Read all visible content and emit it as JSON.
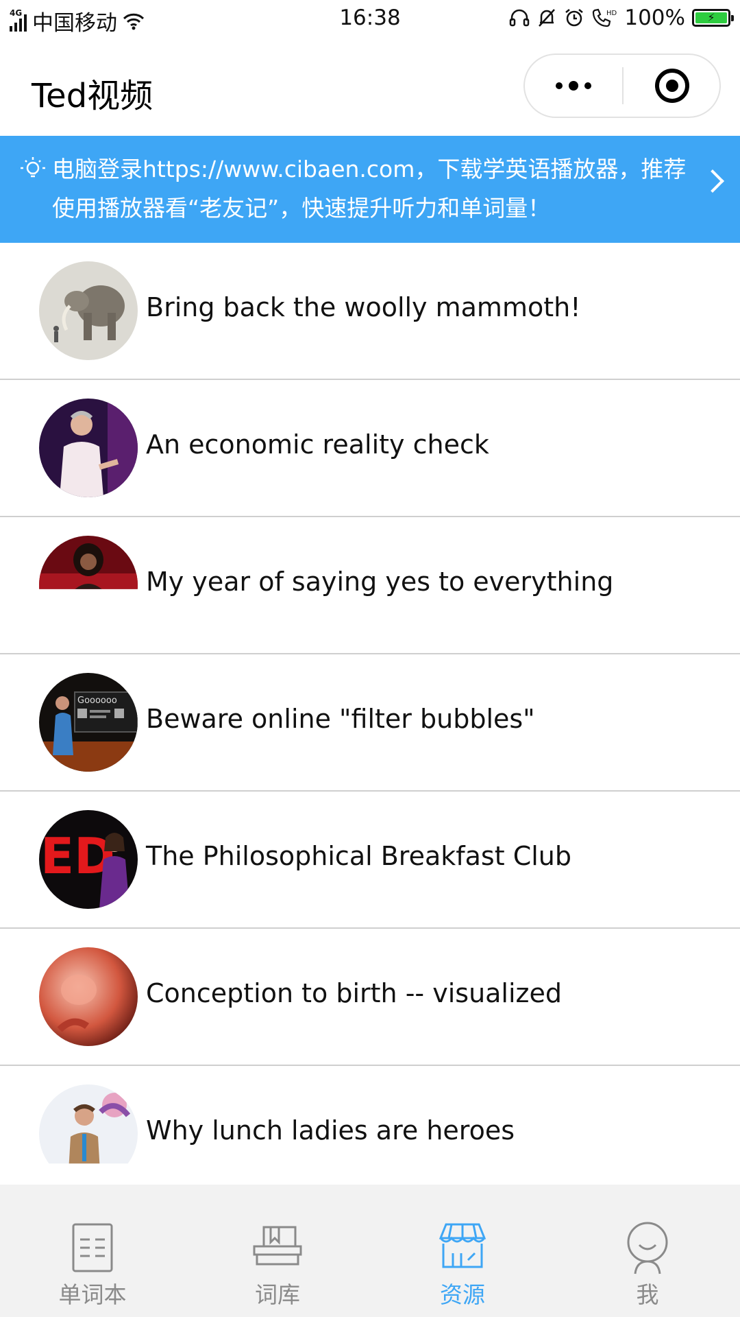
{
  "status_bar": {
    "network": "4G",
    "carrier": "中国移动",
    "time": "16:38",
    "battery": "100%",
    "icons": [
      "signal-icon",
      "wifi-icon",
      "headset-icon",
      "silent-bell-icon",
      "alarm-icon",
      "hd-call-icon",
      "battery-icon"
    ]
  },
  "nav": {
    "title": "Ted视频",
    "more_icon": "more-dots-icon",
    "close_icon": "target-close-icon"
  },
  "notice": {
    "icon": "lightbulb-icon",
    "text": "电脑登录https://www.cibaen.com，下载学英语播放器，推荐使用播放器看“老友记”，快速提升听力和单词量！",
    "arrow_icon": "chevron-right-icon",
    "color": "#3ea6f5"
  },
  "videos": [
    {
      "title": "Bring back the woolly mammoth!"
    },
    {
      "title": "An economic reality check"
    },
    {
      "title": "My year of saying yes to everything"
    },
    {
      "title": "Beware online \"filter bubbles\""
    },
    {
      "title": "The Philosophical Breakfast Club"
    },
    {
      "title": "Conception to birth -- visualized"
    },
    {
      "title": "Why lunch ladies are heroes"
    }
  ],
  "tabs": [
    {
      "label": "单词本",
      "icon": "notebook-icon",
      "active": false
    },
    {
      "label": "词库",
      "icon": "books-icon",
      "active": false
    },
    {
      "label": "资源",
      "icon": "store-icon",
      "active": true
    },
    {
      "label": "我",
      "icon": "profile-icon",
      "active": false
    }
  ],
  "colors": {
    "accent": "#3ea6f5",
    "inactive": "#8a8a8a"
  }
}
